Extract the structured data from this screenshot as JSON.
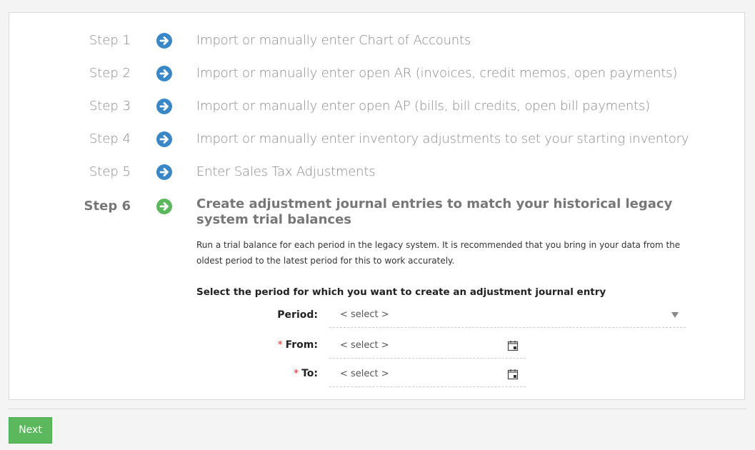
{
  "steps": [
    {
      "label": "Step 1",
      "text": "Import or manually enter Chart of Accounts",
      "icon": "arrow-circle-right-icon",
      "color": "#3a87c8"
    },
    {
      "label": "Step 2",
      "text": "Import or manually enter open AR (invoices, credit memos, open payments)",
      "icon": "arrow-circle-right-icon",
      "color": "#3a87c8"
    },
    {
      "label": "Step 3",
      "text": "Import or manually enter open AP (bills, bill credits, open bill payments)",
      "icon": "arrow-circle-right-icon",
      "color": "#3a87c8"
    },
    {
      "label": "Step 4",
      "text": "Import or manually enter inventory adjustments to set your starting inventory",
      "icon": "arrow-circle-right-icon",
      "color": "#3a87c8"
    },
    {
      "label": "Step 5",
      "text": "Enter Sales Tax Adjustments",
      "icon": "arrow-circle-right-icon",
      "color": "#3a87c8"
    }
  ],
  "active_step": {
    "label": "Step 6",
    "title": "Create adjustment journal entries to match your historical legacy system trial balances",
    "icon": "arrow-circle-right-icon",
    "color": "#5cb85c",
    "description": "Run a trial balance for each period in the legacy system. It is recommended that you bring in your data from the oldest period to the latest period for this to work accurately."
  },
  "form": {
    "heading": "Select the period for which you want to create an adjustment journal entry",
    "period": {
      "label": "Period:",
      "value": "< select >"
    },
    "from": {
      "label": "From:",
      "required_mark": "*",
      "value": "< select >"
    },
    "to": {
      "label": "To:",
      "required_mark": "*",
      "value": "< select >"
    }
  },
  "buttons": {
    "next": "Next"
  }
}
